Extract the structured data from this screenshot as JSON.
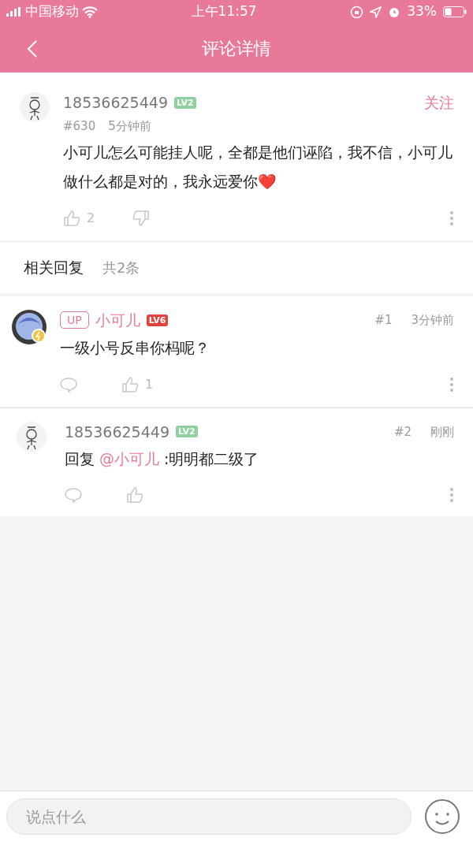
{
  "status_bar": {
    "carrier": "中国移动",
    "time": "上午11:57",
    "battery": "33%"
  },
  "nav": {
    "title": "评论详情"
  },
  "comment": {
    "user": "18536625449",
    "level": {
      "text": "LV2",
      "color": "#8fd19e"
    },
    "follow": "关注",
    "floor": "#630",
    "time": "5分钟前",
    "text": "小可儿怎么可能挂人呢，全都是他们诬陷，我不信，小可儿做什么都是对的，我永远爱你❤️",
    "likes": "2"
  },
  "replies_header": {
    "title": "相关回复",
    "count": "共2条"
  },
  "replies": [
    {
      "kind": "up",
      "up_badge": "UP",
      "user": "小可儿",
      "level": {
        "text": "LV6",
        "color": "#e0443e"
      },
      "floor": "#1",
      "time": "3分钟前",
      "segments": [
        {
          "kind": "text",
          "text": "一级小号反串你杩呢？"
        }
      ],
      "likes": "1"
    },
    {
      "kind": "user",
      "user": "18536625449",
      "level": {
        "text": "LV2",
        "color": "#8fd19e"
      },
      "floor": "#2",
      "time": "刚刚",
      "segments": [
        {
          "kind": "text",
          "text": "回复 "
        },
        {
          "kind": "mention",
          "text": "@小可儿"
        },
        {
          "kind": "text",
          "text": " :明明都二级了"
        }
      ]
    }
  ],
  "input": {
    "placeholder": "说点什么"
  }
}
